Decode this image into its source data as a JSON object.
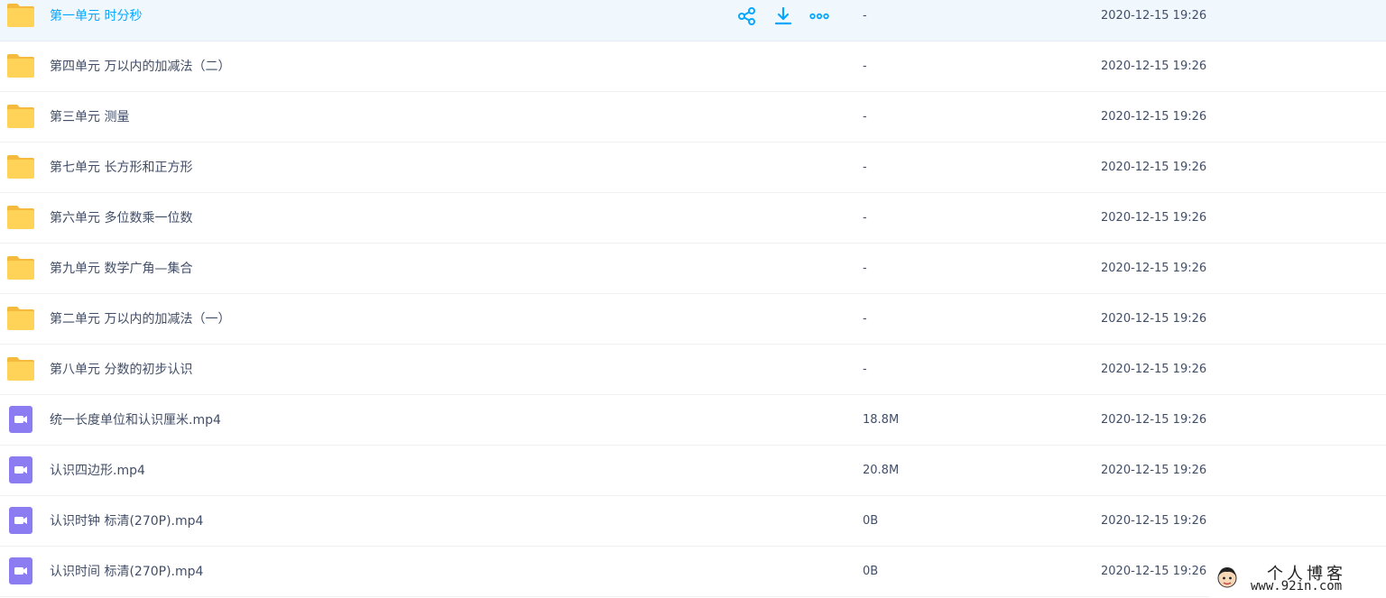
{
  "files": [
    {
      "type": "folder",
      "name": "第一单元 时分秒",
      "size": "-",
      "modified": "2020-12-15 19:26",
      "hover": true
    },
    {
      "type": "folder",
      "name": "第四单元 万以内的加减法（二）",
      "size": "-",
      "modified": "2020-12-15 19:26"
    },
    {
      "type": "folder",
      "name": "第三单元 测量",
      "size": "-",
      "modified": "2020-12-15 19:26"
    },
    {
      "type": "folder",
      "name": "第七单元 长方形和正方形",
      "size": "-",
      "modified": "2020-12-15 19:26"
    },
    {
      "type": "folder",
      "name": "第六单元 多位数乘一位数",
      "size": "-",
      "modified": "2020-12-15 19:26"
    },
    {
      "type": "folder",
      "name": "第九单元 数学广角—集合",
      "size": "-",
      "modified": "2020-12-15 19:26"
    },
    {
      "type": "folder",
      "name": "第二单元 万以内的加减法（一）",
      "size": "-",
      "modified": "2020-12-15 19:26"
    },
    {
      "type": "folder",
      "name": "第八单元 分数的初步认识",
      "size": "-",
      "modified": "2020-12-15 19:26"
    },
    {
      "type": "video",
      "name": "统一长度单位和认识厘米.mp4",
      "size": "18.8M",
      "modified": "2020-12-15 19:26"
    },
    {
      "type": "video",
      "name": "认识四边形.mp4",
      "size": "20.8M",
      "modified": "2020-12-15 19:26"
    },
    {
      "type": "video",
      "name": "认识时钟 标清(270P).mp4",
      "size": "0B",
      "modified": "2020-12-15 19:26"
    },
    {
      "type": "video",
      "name": "认识时间 标清(270P).mp4",
      "size": "0B",
      "modified": "2020-12-15 19:26"
    }
  ],
  "row_actions": [
    {
      "name": "share-icon"
    },
    {
      "name": "download-icon"
    },
    {
      "name": "more-icon"
    }
  ],
  "colors": {
    "accent": "#06a7ff",
    "folder": "#ffd258",
    "video": "#8c7cf2",
    "text": "#424e67",
    "hover_bg": "#f0f8fe"
  },
  "watermark": {
    "title": "个人博客",
    "url": "www.92in.com"
  }
}
